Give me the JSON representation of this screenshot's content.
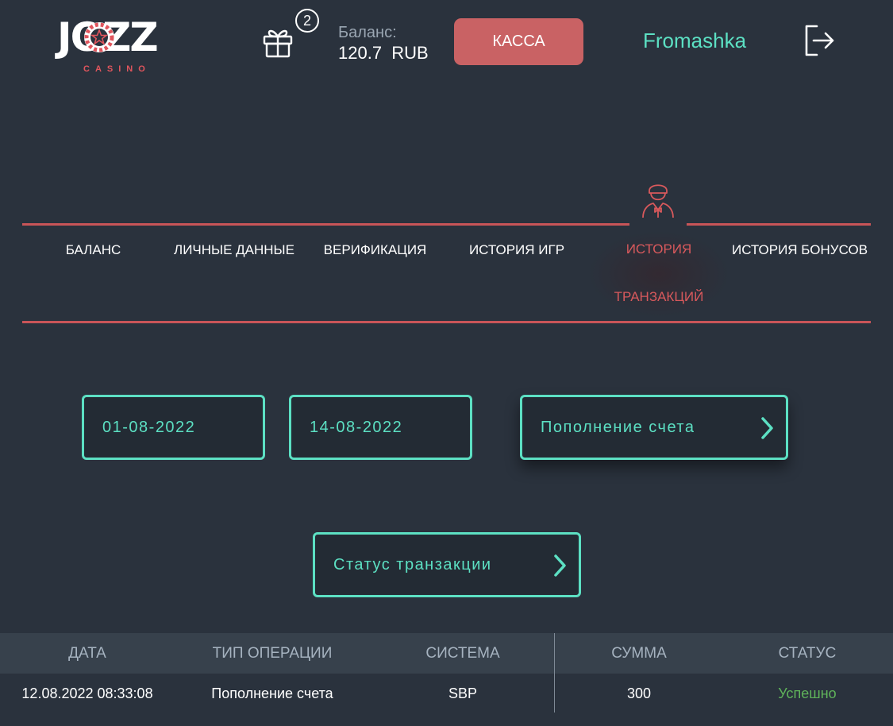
{
  "header": {
    "logo_text": "JOZZ",
    "logo_subtext": "CASINO",
    "gift_icon": "gift-icon",
    "gift_badge_count": "2",
    "balance_label": "Баланс:",
    "balance_value": "120.7  RUB",
    "cashier_button": "КАССА",
    "username": "Fromashka",
    "logout_icon": "logout-icon"
  },
  "tabs": [
    {
      "label": "БАЛАНС",
      "active": false
    },
    {
      "label": "ЛИЧНЫЕ ДАННЫЕ",
      "active": false
    },
    {
      "label": "ВЕРИФИКАЦИЯ",
      "active": false
    },
    {
      "label": "ИСТОРИЯ ИГР",
      "active": false
    },
    {
      "label": "ИСТОРИЯ ТРАНЗАКЦИЙ",
      "active": true
    },
    {
      "label": "ИСТОРИЯ БОНУСОВ",
      "active": false
    }
  ],
  "active_tab_icon": "dealer-icon",
  "filters": {
    "date_from": "01-08-2022",
    "date_to": "14-08-2022",
    "operation_type": "Пополнение счета",
    "transaction_status": "Статус транзакции"
  },
  "table": {
    "columns": [
      "ДАТА",
      "ТИП ОПЕРАЦИИ",
      "СИСТЕМА",
      "СУММА",
      "СТАТУС"
    ],
    "rows": [
      {
        "date": "12.08.2022 08:33:08",
        "type": "Пополнение счета",
        "system": "SBP",
        "amount": "300",
        "status": "Успешно"
      }
    ]
  },
  "colors": {
    "background": "#2a323d",
    "accent_teal": "#5ce0c3",
    "accent_red": "#c96264",
    "status_success": "#5fb35a"
  }
}
